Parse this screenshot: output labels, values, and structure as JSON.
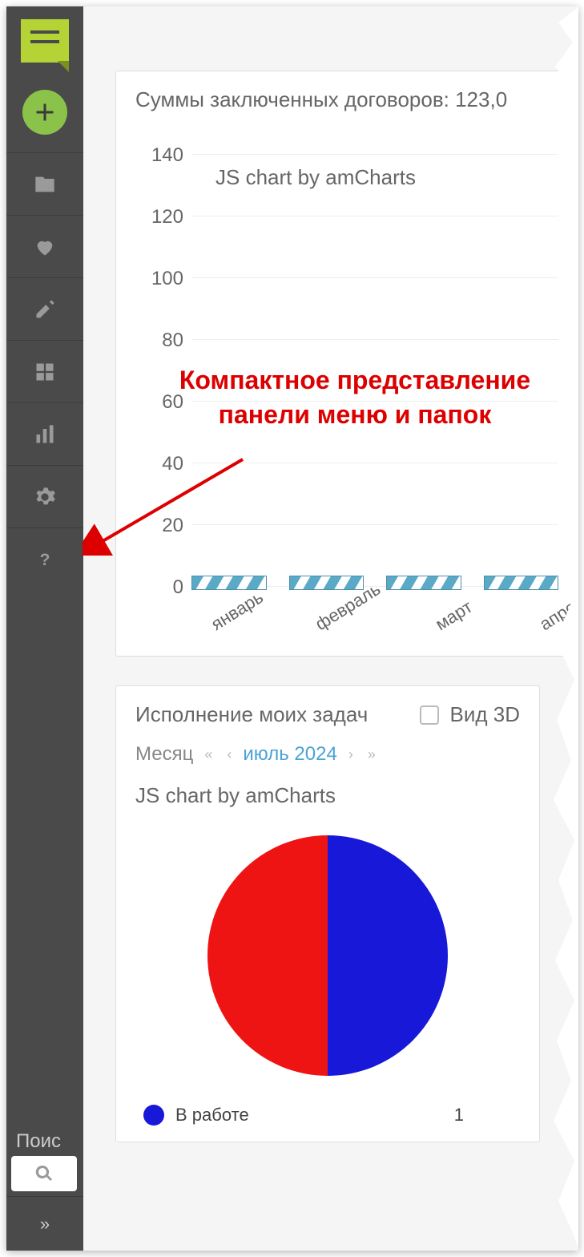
{
  "sidebar": {
    "search_placeholder": "Поис"
  },
  "annotation": {
    "line1": "Компактное представление",
    "line2": "панели меню и папок"
  },
  "panel1": {
    "title": "Суммы заключенных договоров: 123,0",
    "watermark": "JS chart by amCharts"
  },
  "panel2": {
    "title": "Исполнение моих задач",
    "view3d_label": "Вид 3D",
    "month_label": "Месяц",
    "month_value": "июль 2024",
    "watermark": "JS chart by amCharts",
    "legend_label": "В работе",
    "legend_value": "1"
  },
  "chart_data": [
    {
      "type": "bar",
      "title": "Суммы заключенных договоров: 123,0",
      "categories": [
        "январь",
        "февраль",
        "март",
        "апрель"
      ],
      "values": [
        0,
        0,
        0,
        0
      ],
      "ylim": [
        0,
        140
      ],
      "yticks": [
        0,
        20,
        40,
        60,
        80,
        100,
        120,
        140
      ],
      "xlabel": "",
      "ylabel": ""
    },
    {
      "type": "pie",
      "title": "Исполнение моих задач",
      "series": [
        {
          "name": "В работе",
          "value": 1,
          "color": "#1818d8"
        },
        {
          "name": "",
          "value": 1,
          "color": "#ef1414"
        }
      ]
    }
  ]
}
